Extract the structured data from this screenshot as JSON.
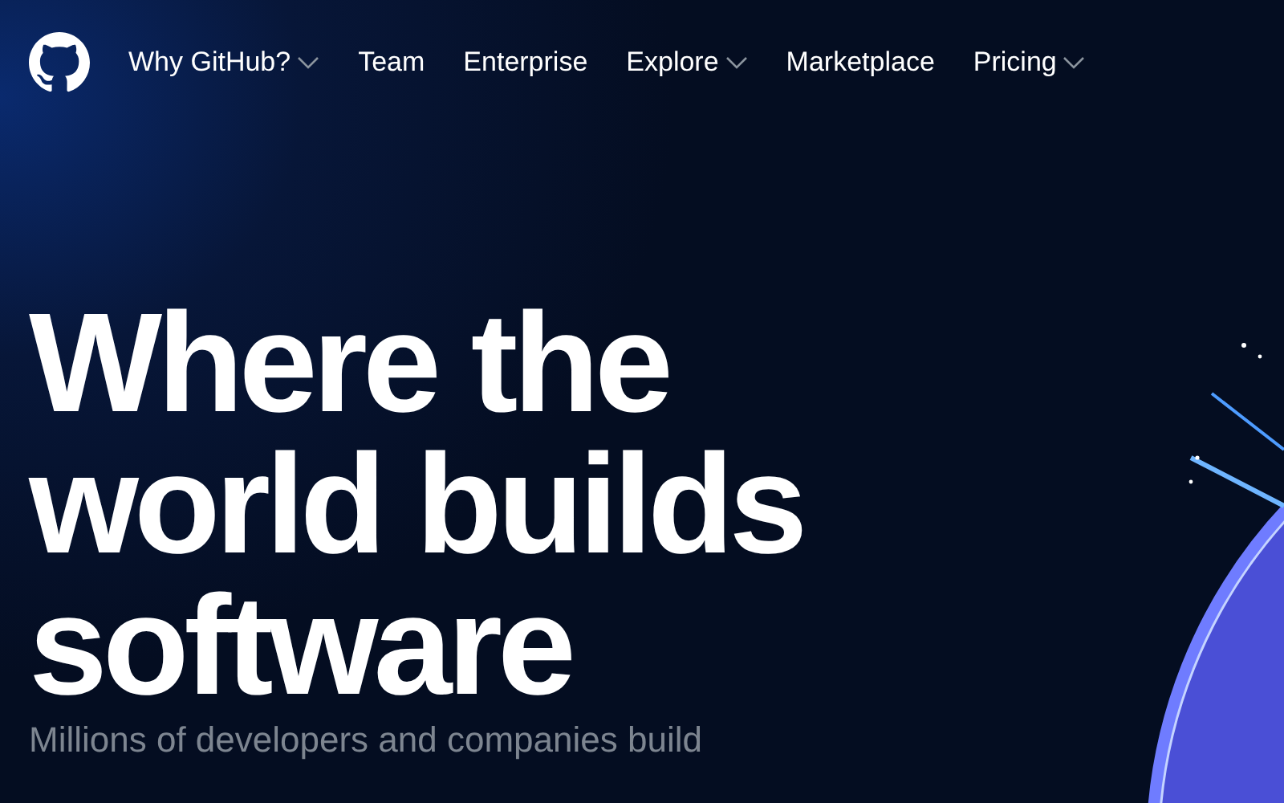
{
  "nav": {
    "items": [
      {
        "label": "Why GitHub?",
        "dropdown": true
      },
      {
        "label": "Team",
        "dropdown": false
      },
      {
        "label": "Enterprise",
        "dropdown": false
      },
      {
        "label": "Explore",
        "dropdown": true
      },
      {
        "label": "Marketplace",
        "dropdown": false
      },
      {
        "label": "Pricing",
        "dropdown": true
      }
    ]
  },
  "hero": {
    "headline_lines": [
      "Where the",
      "world builds",
      "software"
    ],
    "subtitle": "Millions of developers and companies build"
  }
}
